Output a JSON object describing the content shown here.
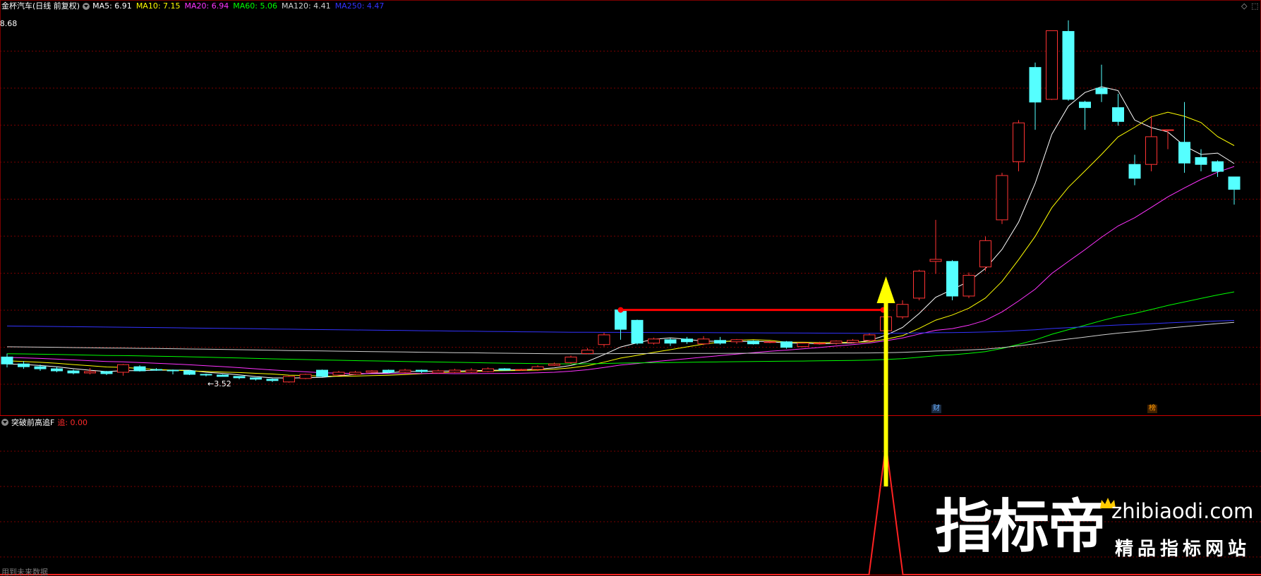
{
  "header": {
    "title": "金杯汽车(日线 前复权)",
    "ma": [
      {
        "label": "MA5: 6.91",
        "color": "#ffffff"
      },
      {
        "label": "MA10: 7.15",
        "color": "#ffff00"
      },
      {
        "label": "MA20: 6.94",
        "color": "#ff33ff"
      },
      {
        "label": "MA60: 5.06",
        "color": "#00ff00"
      },
      {
        "label": "MA120: 4.41",
        "color": "#d0d0d0"
      },
      {
        "label": "MA250: 4.47",
        "color": "#3333ff"
      }
    ],
    "controls": [
      "◇",
      "⬚"
    ]
  },
  "price_chart": {
    "high_label": "8.68",
    "low_label": "3.52",
    "badges": [
      {
        "label": "财",
        "color": "#6ab0ff"
      },
      {
        "label": "榜",
        "color": "#ff9900"
      }
    ],
    "colors": {
      "up": "#ff3333",
      "down": "#55ffff",
      "grid": "#7a0000",
      "breakout": "#ff0000",
      "arrow": "#ffff00"
    }
  },
  "indicator": {
    "name": "突破前高追F",
    "value_label": "追: 0.00",
    "value_color": "#ff2a2a"
  },
  "footer": {
    "note": "用到未来数据"
  },
  "watermark": {
    "brand_cn": "指标帝",
    "domain": "zhibiaodi.com",
    "slogan": "精品指标网站"
  },
  "chart_data": {
    "type": "candlestick",
    "ohlc": [
      [
        3.8,
        3.7,
        3.85,
        3.65
      ],
      [
        3.7,
        3.66,
        3.74,
        3.63
      ],
      [
        3.66,
        3.63,
        3.69,
        3.6
      ],
      [
        3.63,
        3.6,
        3.66,
        3.58
      ],
      [
        3.6,
        3.57,
        3.62,
        3.55
      ],
      [
        3.57,
        3.59,
        3.64,
        3.55
      ],
      [
        3.59,
        3.56,
        3.6,
        3.54
      ],
      [
        3.58,
        3.69,
        3.7,
        3.53
      ],
      [
        3.66,
        3.6,
        3.68,
        3.59
      ],
      [
        3.62,
        3.61,
        3.64,
        3.6
      ],
      [
        3.61,
        3.6,
        3.62,
        3.55
      ],
      [
        3.6,
        3.55,
        3.61,
        3.54
      ],
      [
        3.55,
        3.54,
        3.56,
        3.52
      ],
      [
        3.54,
        3.52,
        3.55,
        3.52
      ],
      [
        3.52,
        3.5,
        3.52,
        3.48
      ],
      [
        3.5,
        3.48,
        3.5,
        3.46
      ],
      [
        3.48,
        3.46,
        3.49,
        3.44
      ],
      [
        3.44,
        3.52,
        3.53,
        3.43
      ],
      [
        3.49,
        3.55,
        3.56,
        3.48
      ],
      [
        3.61,
        3.52,
        3.62,
        3.51
      ],
      [
        3.54,
        3.58,
        3.6,
        3.53
      ],
      [
        3.55,
        3.58,
        3.6,
        3.54
      ],
      [
        3.58,
        3.6,
        3.61,
        3.57
      ],
      [
        3.61,
        3.58,
        3.62,
        3.57
      ],
      [
        3.58,
        3.61,
        3.63,
        3.57
      ],
      [
        3.61,
        3.59,
        3.62,
        3.57
      ],
      [
        3.57,
        3.6,
        3.62,
        3.56
      ],
      [
        3.58,
        3.61,
        3.63,
        3.57
      ],
      [
        3.58,
        3.61,
        3.64,
        3.57
      ],
      [
        3.59,
        3.63,
        3.65,
        3.58
      ],
      [
        3.63,
        3.61,
        3.64,
        3.6
      ],
      [
        3.61,
        3.62,
        3.63,
        3.6
      ],
      [
        3.62,
        3.66,
        3.68,
        3.6
      ],
      [
        3.68,
        3.7,
        3.72,
        3.67
      ],
      [
        3.72,
        3.8,
        3.82,
        3.7
      ],
      [
        3.85,
        3.9,
        3.93,
        3.84
      ],
      [
        3.98,
        4.12,
        4.15,
        3.95
      ],
      [
        4.48,
        4.2,
        4.5,
        4.05
      ],
      [
        4.33,
        4.0,
        4.34,
        3.98
      ],
      [
        4.0,
        4.06,
        4.08,
        3.98
      ],
      [
        4.05,
        4.0,
        4.07,
        3.96
      ],
      [
        4.06,
        4.02,
        4.09,
        3.99
      ],
      [
        3.99,
        4.06,
        4.1,
        3.97
      ],
      [
        4.04,
        4.0,
        4.09,
        3.98
      ],
      [
        4.02,
        4.05,
        4.06,
        3.99
      ],
      [
        4.03,
        3.99,
        4.04,
        3.98
      ],
      [
        4.02,
        4.02,
        4.03,
        4.0
      ],
      [
        4.02,
        3.94,
        4.03,
        3.92
      ],
      [
        3.95,
        4.0,
        4.01,
        3.94
      ],
      [
        3.99,
        4.0,
        4.02,
        3.98
      ],
      [
        4.0,
        4.03,
        4.04,
        3.98
      ],
      [
        4.01,
        4.04,
        4.06,
        4.0
      ],
      [
        4.04,
        4.12,
        4.14,
        4.02
      ],
      [
        4.18,
        4.38,
        4.4,
        4.18
      ],
      [
        4.38,
        4.56,
        4.62,
        4.35
      ],
      [
        4.65,
        5.04,
        5.06,
        4.62
      ],
      [
        5.18,
        5.21,
        5.78,
        5.0
      ],
      [
        5.18,
        4.68,
        5.2,
        4.62
      ],
      [
        4.68,
        4.98,
        5.02,
        4.65
      ],
      [
        5.1,
        5.48,
        5.54,
        5.04
      ],
      [
        5.78,
        6.42,
        6.46,
        5.72
      ],
      [
        6.62,
        7.18,
        7.22,
        6.48
      ],
      [
        7.98,
        7.48,
        8.05,
        7.08
      ],
      [
        7.52,
        8.51,
        8.51,
        7.51
      ],
      [
        8.5,
        7.52,
        8.66,
        7.5
      ],
      [
        7.48,
        7.4,
        7.5,
        7.08
      ],
      [
        7.68,
        7.6,
        8.02,
        7.48
      ],
      [
        7.4,
        7.2,
        7.6,
        7.14
      ],
      [
        6.58,
        6.38,
        6.72,
        6.28
      ],
      [
        6.58,
        6.98,
        7.28,
        6.48
      ],
      [
        7.08,
        7.08,
        7.08,
        6.8
      ],
      [
        6.9,
        6.6,
        7.48,
        6.46
      ],
      [
        6.68,
        6.58,
        6.8,
        6.48
      ],
      [
        6.62,
        6.48,
        6.64,
        6.4
      ],
      [
        6.4,
        6.22,
        6.4,
        6.0
      ]
    ],
    "high": 8.68,
    "low": 3.52,
    "ma_lines": [
      {
        "name": "MA5",
        "color": "#ffffff"
      },
      {
        "name": "MA10",
        "color": "#ffff00"
      },
      {
        "name": "MA20",
        "color": "#ff33ff"
      },
      {
        "name": "MA60",
        "color": "#00ff00"
      },
      {
        "name": "MA120",
        "color": "#d0d0d0"
      },
      {
        "name": "MA250",
        "color": "#3333ff"
      }
    ],
    "breakout": {
      "from_index": 37,
      "to_index": 53,
      "level": 4.48
    },
    "indicator_values": {
      "peak_index": 53,
      "peak_value": 1,
      "other": 0
    }
  }
}
